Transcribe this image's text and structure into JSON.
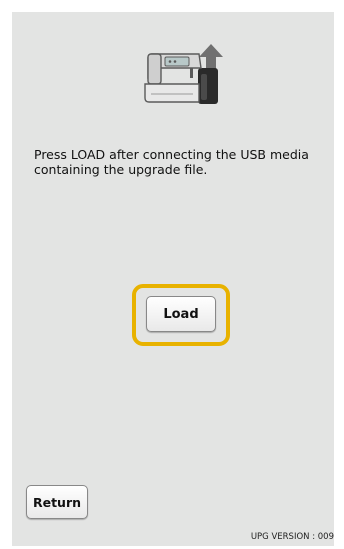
{
  "illustration": {
    "icon": "sewing-machine-upgrade-icon"
  },
  "message": {
    "text": "Press LOAD after connecting the USB media\ncontaining the upgrade file."
  },
  "buttons": {
    "load_label": "Load",
    "return_label": "Return"
  },
  "footer": {
    "version": "UPG VERSION : 009"
  },
  "colors": {
    "background": "#e3e4e3",
    "highlight": "#e8b200"
  }
}
